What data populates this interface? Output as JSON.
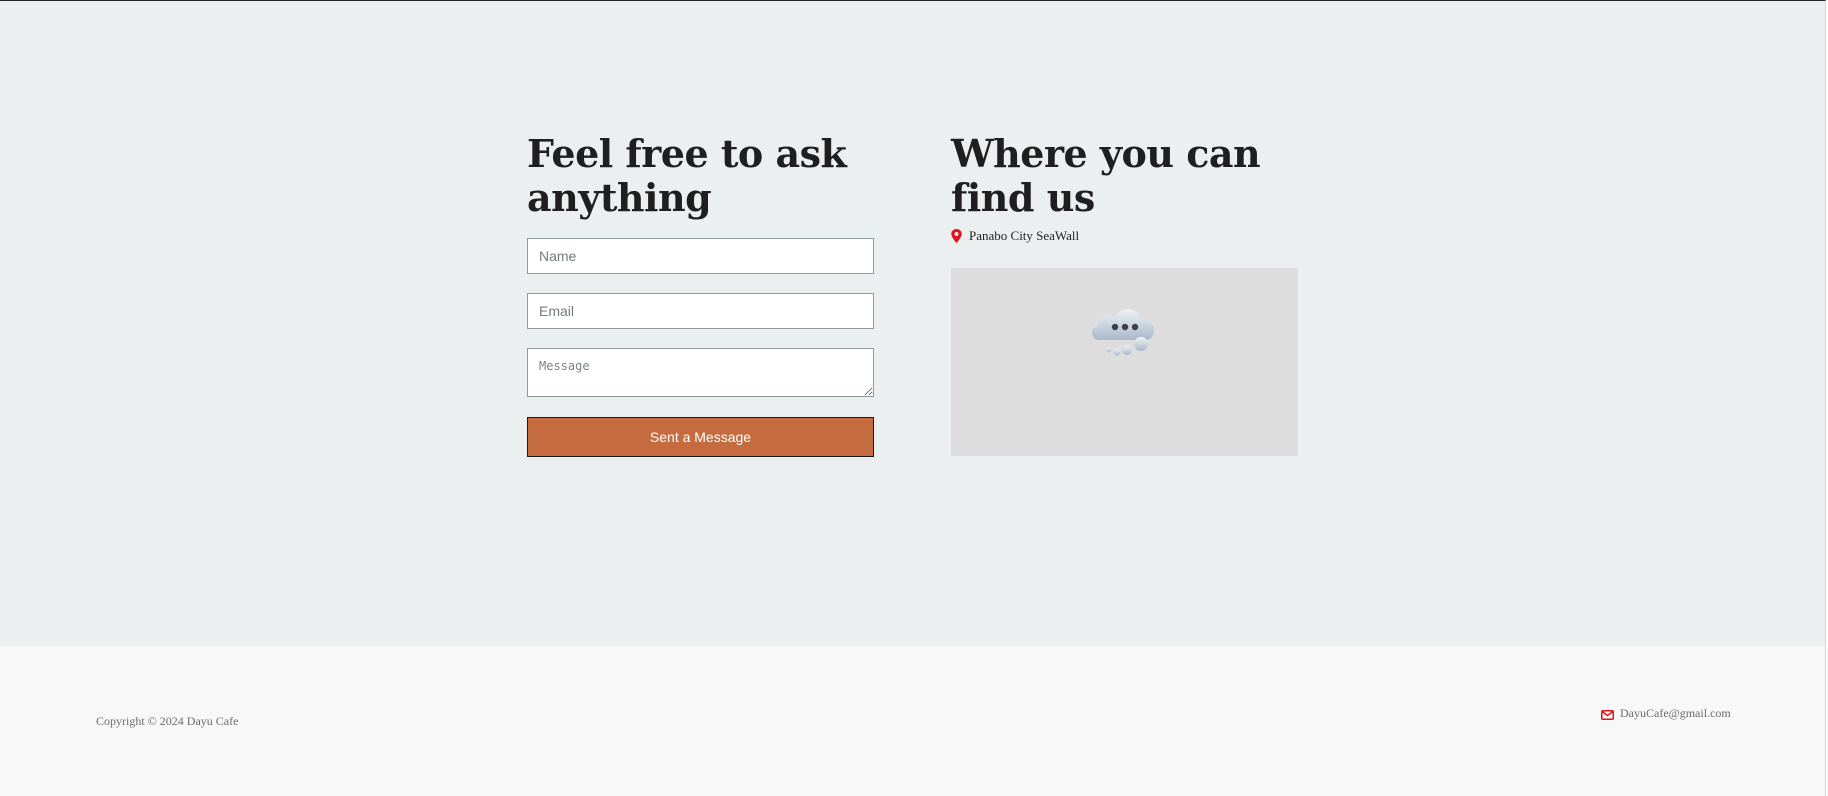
{
  "contact": {
    "heading": "Feel free to ask anything",
    "name_placeholder": "Name",
    "email_placeholder": "Email",
    "message_placeholder": "Message",
    "send_label": "Sent a Message"
  },
  "location": {
    "heading": "Where you can find us",
    "address": "Panabo City SeaWall",
    "pin_icon": "map-pin-icon",
    "pin_color": "#e0141e",
    "map_placeholder_icon": "cloud-loading-icon"
  },
  "footer": {
    "copyright": "Copyright © 2024 Dayu Cafe",
    "email": "DayuCafe@gmail.com",
    "email_icon": "envelope-icon",
    "email_icon_color": "#e0141e"
  },
  "colors": {
    "background": "#ecefef",
    "footer_background": "#f8f8f8",
    "button": "#c46c40",
    "map_background": "#dddddd"
  }
}
